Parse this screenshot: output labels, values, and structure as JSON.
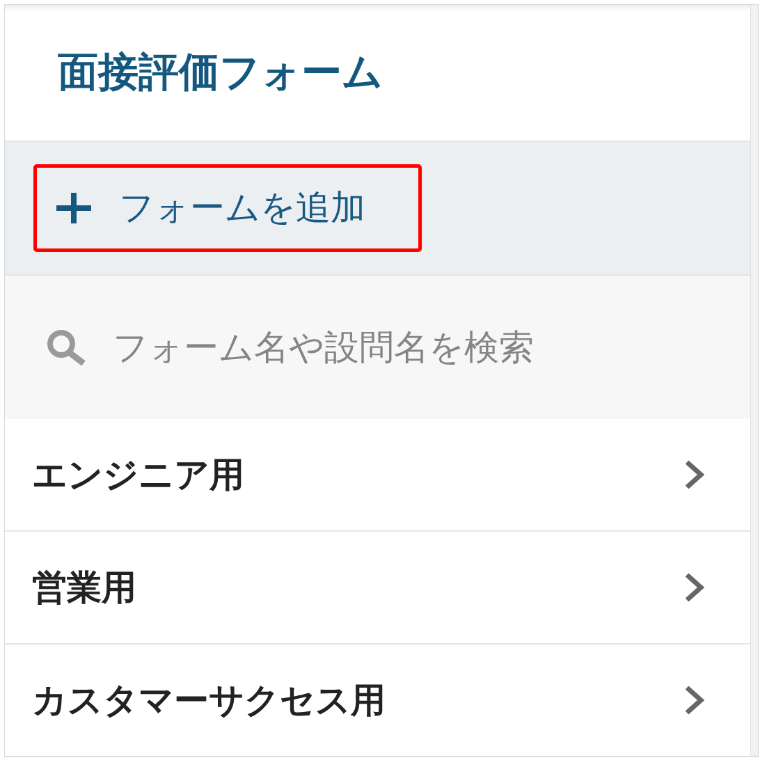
{
  "header": {
    "title": "面接評価フォーム"
  },
  "add_button": {
    "label": "フォームを追加",
    "highlighted": true
  },
  "search": {
    "placeholder": "フォーム名や設問名を検索"
  },
  "forms": [
    {
      "label": "エンジニア用"
    },
    {
      "label": "営業用"
    },
    {
      "label": "カスタマーサクセス用"
    }
  ]
}
